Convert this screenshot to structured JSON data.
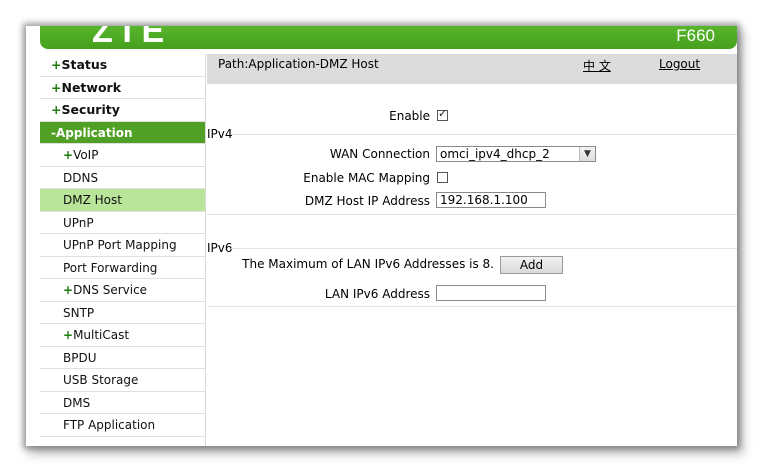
{
  "header": {
    "logo": "ZTE",
    "model": "F660",
    "brand_color": "#4fa024"
  },
  "sidebar": {
    "items": [
      {
        "label": "Status",
        "prefix": "+"
      },
      {
        "label": "Network",
        "prefix": "+"
      },
      {
        "label": "Security",
        "prefix": "+"
      },
      {
        "label": "Application",
        "prefix": "-"
      },
      {
        "label": "VoIP",
        "prefix": "+"
      },
      {
        "label": "DDNS"
      },
      {
        "label": "DMZ Host"
      },
      {
        "label": "UPnP"
      },
      {
        "label": "UPnP Port Mapping"
      },
      {
        "label": "Port Forwarding"
      },
      {
        "label": "DNS Service",
        "prefix": "+"
      },
      {
        "label": "SNTP"
      },
      {
        "label": "MultiCast",
        "prefix": "+"
      },
      {
        "label": "BPDU"
      },
      {
        "label": "USB Storage"
      },
      {
        "label": "DMS"
      },
      {
        "label": "FTP Application"
      }
    ]
  },
  "pathbar": {
    "path": "Path:Application-DMZ Host",
    "language": "中 文",
    "logout": "Logout"
  },
  "form": {
    "enable_label": "Enable",
    "enable_checked": true,
    "ipv4_title": "IPv4",
    "wan_label": "WAN Connection",
    "wan_value": "omci_ipv4_dhcp_2",
    "mac_label": "Enable MAC Mapping",
    "mac_checked": false,
    "dmz_ip_label": "DMZ Host IP Address",
    "dmz_ip_value": "192.168.1.100",
    "ipv6_title": "IPv6",
    "max_ipv6_text": "The Maximum of LAN IPv6 Addresses is 8.",
    "add_label": "Add",
    "lan_ipv6_label": "LAN IPv6 Address",
    "lan_ipv6_value": ""
  }
}
